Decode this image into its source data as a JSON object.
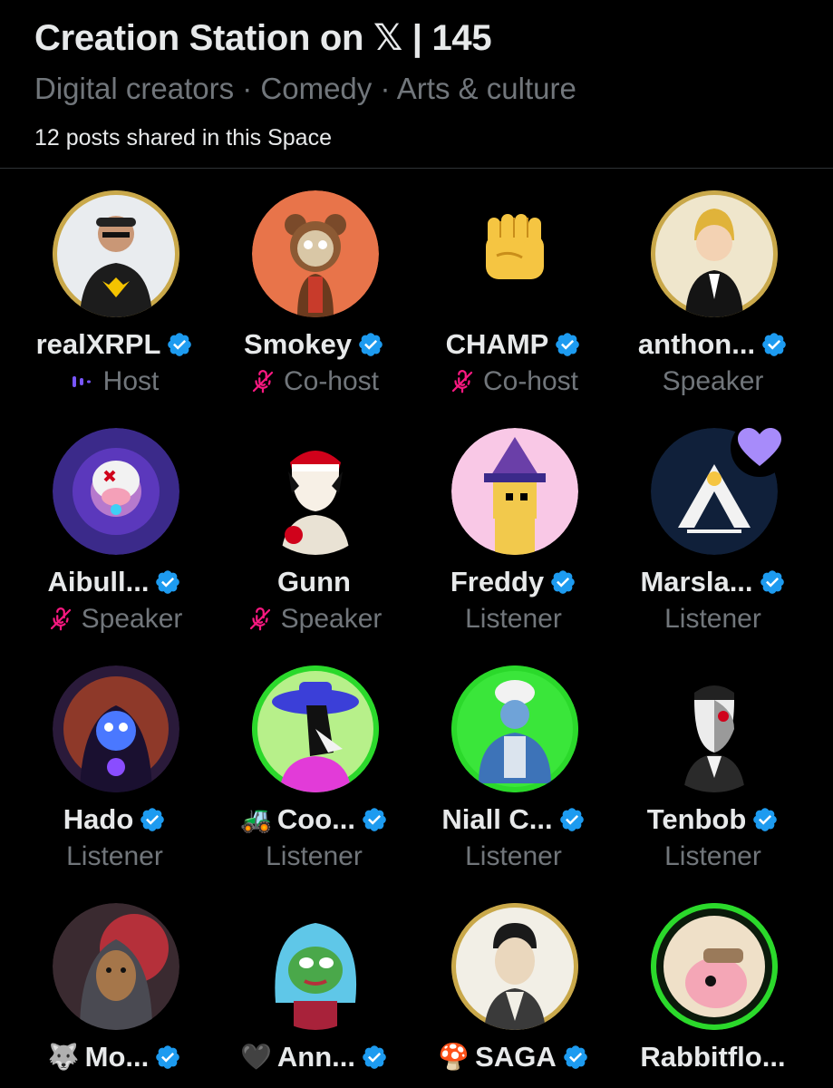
{
  "space": {
    "title": "Creation Station on 𝕏 | 145",
    "topics": "Digital creators · Comedy · Arts & culture",
    "posts_shared": "12 posts shared in this Space"
  },
  "colors": {
    "background": "#000000",
    "text_primary": "#e7e9ea",
    "text_secondary": "#71767b",
    "verified_blue": "#1d9bf0",
    "muted_pink": "#f91880",
    "speaking_purple": "#7856ff",
    "heart_purple": "#a78bfa"
  },
  "participants": [
    {
      "name": "realXRPL",
      "role": "Host",
      "verified": true,
      "status_icon": "speaking-icon",
      "ring": "gold"
    },
    {
      "name": "Smokey",
      "role": "Co-host",
      "verified": true,
      "status_icon": "mic-off-icon"
    },
    {
      "name": "CHAMP",
      "role": "Co-host",
      "verified": true,
      "status_icon": "mic-off-icon"
    },
    {
      "name": "anthon...",
      "role": "Speaker",
      "verified": true,
      "ring": "gold"
    },
    {
      "name": "Aibull...",
      "role": "Speaker",
      "verified": true,
      "status_icon": "mic-off-icon"
    },
    {
      "name": "Gunn",
      "role": "Speaker",
      "verified": false,
      "status_icon": "mic-off-icon"
    },
    {
      "name": "Freddy",
      "role": "Listener",
      "verified": true
    },
    {
      "name": "Marsla...",
      "role": "Listener",
      "verified": true,
      "reaction": "purple-heart-icon"
    },
    {
      "name": "Hado",
      "role": "Listener",
      "verified": true
    },
    {
      "name": "Coo...",
      "role": "Listener",
      "verified": true,
      "prefix_emoji": "🚜",
      "ring": "green"
    },
    {
      "name": "Niall C...",
      "role": "Listener",
      "verified": true,
      "ring": "green"
    },
    {
      "name": "Tenbob",
      "role": "Listener",
      "verified": true
    },
    {
      "name": "Mo...",
      "verified": true,
      "prefix_emoji": "🐺"
    },
    {
      "name": "Ann...",
      "verified": true,
      "prefix_emoji": "🖤"
    },
    {
      "name": "SAGA",
      "verified": true,
      "prefix_emoji": "🍄",
      "ring": "gold"
    },
    {
      "name": "Rabbitflo...",
      "verified": false,
      "ring": "green"
    }
  ]
}
